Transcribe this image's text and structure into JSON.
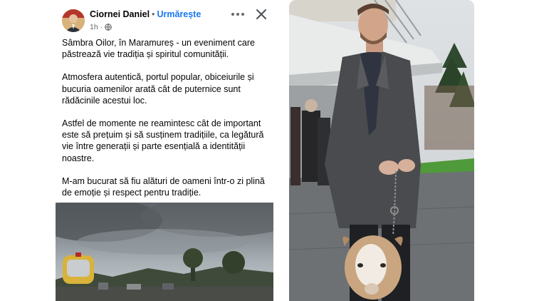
{
  "post": {
    "author": "Ciornei Daniel",
    "separator": "•",
    "follow_label": "Urmărește",
    "time": "1h",
    "privacy_icon": "globe-icon",
    "more_icon": "more-icon",
    "close_icon": "close-icon",
    "paragraphs": [
      "Sâmbra Oilor, în Maramureș - un eveniment care păstrează vie tradiția și spiritul comunității.",
      "Atmosfera autentică, portul popular, obiceiurile și bucuria oamenilor arată cât de puternice sunt rădăcinile acestui loc.",
      "Astfel de momente ne reamintesc cât de important este să prețuim și să susținem tradițiile, ca legătură vie între generații și parte esențială a identității noastre.",
      "M-am bucurat să fiu alături de oameni într-o zi plină de emoție și respect pentru tradiție."
    ]
  },
  "colors": {
    "link_blue": "#1877f2",
    "text": "#050505",
    "muted": "#65676b"
  }
}
